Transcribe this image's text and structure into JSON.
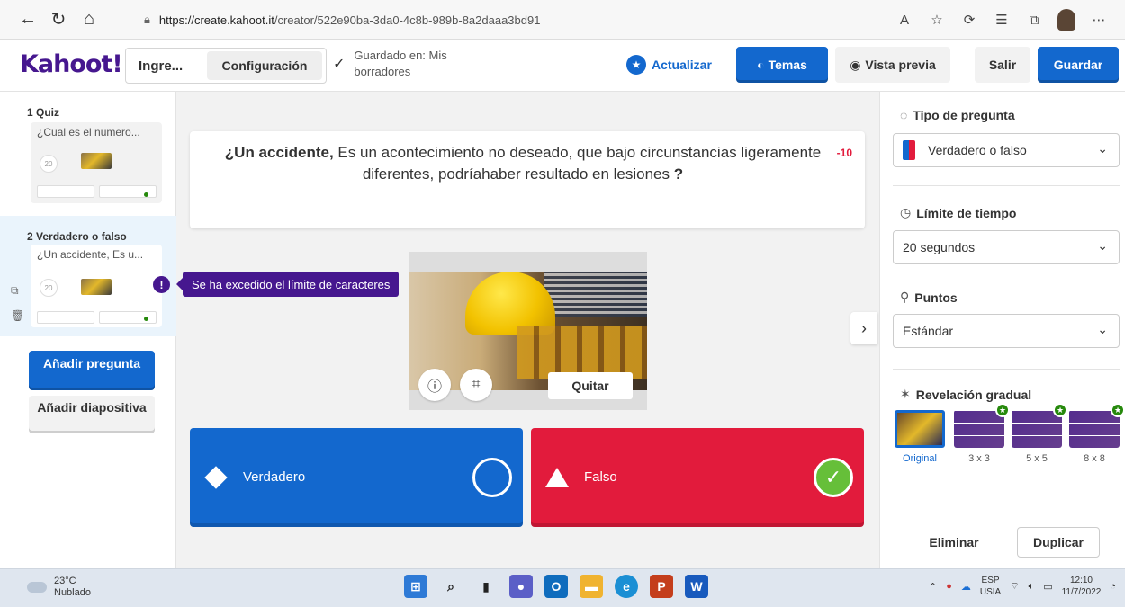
{
  "browser": {
    "url_host": "https://create.kahoot.it",
    "url_path": "/creator/522e90ba-3da0-4c8b-989b-8a2daaa3bd91"
  },
  "header": {
    "logo": "Kahoot!",
    "title": "Ingre...",
    "config_label": "Configuración",
    "saved_text": "Guardado en: Mis borradores",
    "upgrade_label": "Actualizar",
    "themes_label": "Temas",
    "preview_label": "Vista previa",
    "exit_label": "Salir",
    "save_label": "Guardar"
  },
  "sidebar": {
    "slides": [
      {
        "label": "1 Quiz",
        "preview": "¿Cual es el numero...",
        "timer": "20"
      },
      {
        "label": "2 Verdadero o falso",
        "preview": "¿Un accidente, Es u...",
        "timer": "20"
      }
    ],
    "add_question": "Añadir pregunta",
    "add_slide": "Añadir diapositiva"
  },
  "tooltip": {
    "icon": "!",
    "text": "Se ha excedido el límite de caracteres"
  },
  "question": {
    "bold_part": "¿Un accidente,",
    "text_part": " Es un acontecimiento no deseado, que bajo circunstancias ligeramente diferentes, podríahaber resultado en lesiones ",
    "end_part": "?",
    "char_count": "-10"
  },
  "media": {
    "remove_label": "Quitar"
  },
  "answers": [
    {
      "label": "Verdadero",
      "color": "#1368ce",
      "shape": "diamond",
      "correct": false
    },
    {
      "label": "Falso",
      "color": "#e21b3c",
      "shape": "triangle",
      "correct": true
    }
  ],
  "panel": {
    "question_type_label": "Tipo de pregunta",
    "question_type_value": "Verdadero o falso",
    "time_limit_label": "Límite de tiempo",
    "time_limit_value": "20 segundos",
    "points_label": "Puntos",
    "points_value": "Estándar",
    "reveal_label": "Revelación gradual",
    "reveal_options": [
      "Original",
      "3 x 3",
      "5 x 5",
      "8 x 8"
    ],
    "delete_label": "Eliminar",
    "duplicate_label": "Duplicar"
  },
  "taskbar": {
    "temp": "23°C",
    "condition": "Nublado",
    "lang_1": "ESP",
    "lang_2": "USIA",
    "time": "12:10",
    "date": "11/7/2022"
  }
}
